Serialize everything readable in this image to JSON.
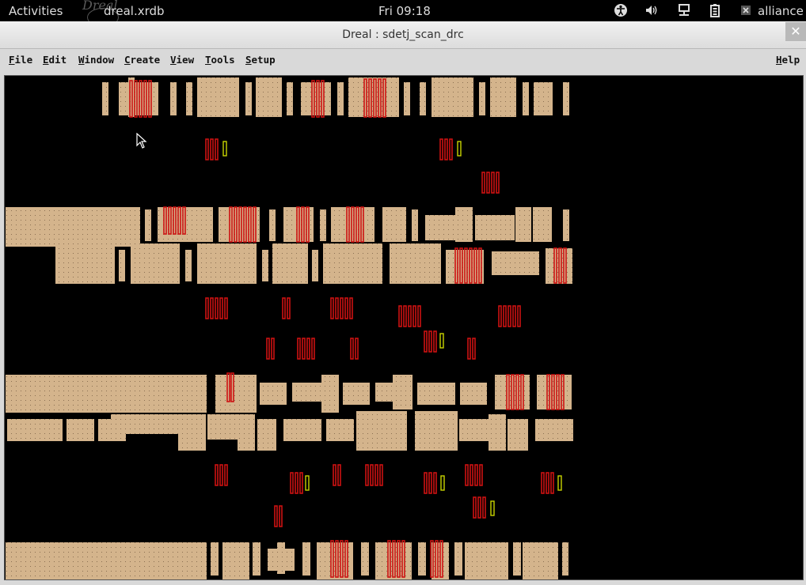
{
  "topbar": {
    "activities": "Activities",
    "app_title": "dreal.xrdb",
    "clock": "Fri 09:18",
    "user": "alliance",
    "ghost_logo_text": "Dreal",
    "icons": [
      "accessibility-icon",
      "volume-icon",
      "network-icon",
      "battery-icon",
      "user-icon"
    ]
  },
  "window": {
    "title": "Dreal : sdetj_scan_drc",
    "close_glyph": "✕"
  },
  "menu": {
    "file": "File",
    "edit": "Edit",
    "window": "Window",
    "create": "Create",
    "view": "View",
    "tools": "Tools",
    "setup": "Setup",
    "help": "Help"
  },
  "colors": {
    "layout_background": "#000000",
    "cell_fill": "#d4b48c",
    "cell_dots": "#8a6f52",
    "drc_violation": "#cc1111",
    "drc_highlight": "#c8d400"
  }
}
